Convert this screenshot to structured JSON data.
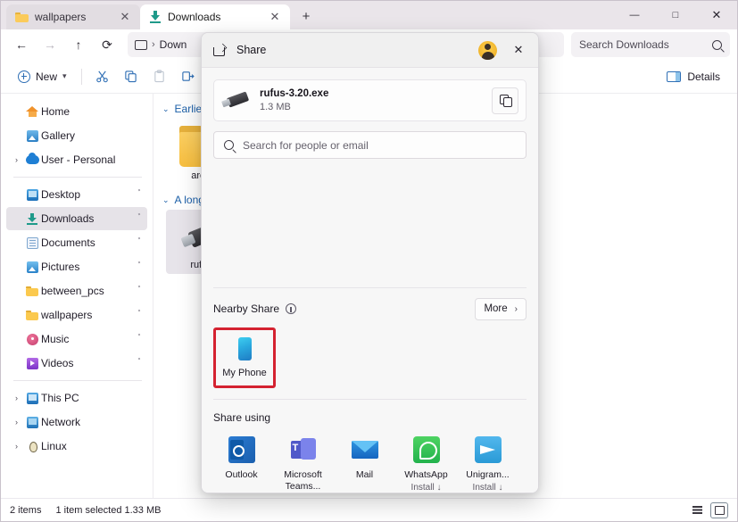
{
  "window": {
    "tabs": [
      {
        "label": "wallpapers",
        "icon": "folder-icon",
        "active": false
      },
      {
        "label": "Downloads",
        "icon": "download-icon",
        "active": true
      }
    ],
    "new_tab_glyph": "+",
    "controls": {
      "minimize": "—",
      "maximize": "□",
      "close": "✕"
    }
  },
  "nav": {
    "back": "←",
    "forward": "→",
    "up": "↑",
    "refresh": "⟳",
    "breadcrumb_sep": "›",
    "breadcrumb_text": "Down",
    "search_placeholder": "Search Downloads",
    "search_icon": "search-icon"
  },
  "toolbar": {
    "new_label": "New",
    "new_caret": "⌄",
    "cut_icon": "scissors-icon",
    "copy_icon": "copy-icon",
    "paste_icon": "paste-icon",
    "rename_icon": "rename-icon",
    "details_label": "Details"
  },
  "sidebar": {
    "items": [
      {
        "label": "Home",
        "icon": "home-icon",
        "chevron": "",
        "pin": false,
        "selected": false
      },
      {
        "label": "Gallery",
        "icon": "gallery-icon",
        "chevron": "",
        "pin": false,
        "selected": false
      },
      {
        "label": "User - Personal",
        "icon": "onedrive-icon",
        "chevron": "›",
        "pin": false,
        "selected": false
      },
      {
        "label": "Desktop",
        "icon": "desktop-icon",
        "chevron": "",
        "pin": true,
        "selected": false
      },
      {
        "label": "Downloads",
        "icon": "downloads-icon",
        "chevron": "",
        "pin": true,
        "selected": true
      },
      {
        "label": "Documents",
        "icon": "documents-icon",
        "chevron": "",
        "pin": true,
        "selected": false
      },
      {
        "label": "Pictures",
        "icon": "pictures-icon",
        "chevron": "",
        "pin": true,
        "selected": false
      },
      {
        "label": "between_pcs",
        "icon": "folder-icon",
        "chevron": "",
        "pin": true,
        "selected": false
      },
      {
        "label": "wallpapers",
        "icon": "folder-icon",
        "chevron": "",
        "pin": true,
        "selected": false
      },
      {
        "label": "Music",
        "icon": "music-icon",
        "chevron": "",
        "pin": true,
        "selected": false
      },
      {
        "label": "Videos",
        "icon": "videos-icon",
        "chevron": "",
        "pin": true,
        "selected": false
      },
      {
        "label": "This PC",
        "icon": "pc-icon",
        "chevron": "›",
        "pin": false,
        "selected": false
      },
      {
        "label": "Network",
        "icon": "network-icon",
        "chevron": "›",
        "pin": false,
        "selected": false
      },
      {
        "label": "Linux",
        "icon": "linux-icon",
        "chevron": "›",
        "pin": false,
        "selected": false
      }
    ],
    "pin_glyph": "ᐩ"
  },
  "content": {
    "groups": [
      {
        "header": "Earlier t",
        "chevron": "⌄",
        "item": {
          "label": "archiva",
          "type": "folder",
          "selected": false
        }
      },
      {
        "header": "A long t",
        "chevron": "⌄",
        "item": {
          "label": "rufus-3.",
          "type": "usb",
          "selected": true
        }
      }
    ]
  },
  "status": {
    "item_count": "2 items",
    "selection": "1 item selected  1.33 MB",
    "view_list_icon": "list-view-icon",
    "view_grid_icon": "large-icons-view-icon"
  },
  "share_dialog": {
    "title": "Share",
    "share_icon": "share-icon",
    "avatar": "account-avatar",
    "close_glyph": "✕",
    "file": {
      "name": "rufus-3.20.exe",
      "size": "1.3 MB",
      "thumbnail": "usb-drive-icon",
      "copy_icon": "copy-link-icon"
    },
    "people_search_placeholder": "Search for people or email",
    "nearby": {
      "title": "Nearby Share",
      "info_icon": "info-icon",
      "more_label": "More",
      "more_chevron": "›",
      "devices": [
        {
          "name": "My Phone",
          "icon": "phone-icon",
          "highlighted": true
        }
      ]
    },
    "share_using": {
      "title": "Share using",
      "apps": [
        {
          "name": "Outlook",
          "icon": "outlook-icon",
          "install": ""
        },
        {
          "name": "Microsoft Teams...",
          "icon": "teams-icon",
          "install": ""
        },
        {
          "name": "Mail",
          "icon": "mail-icon",
          "install": ""
        },
        {
          "name": "WhatsApp",
          "icon": "whatsapp-icon",
          "install": "Install ↓"
        },
        {
          "name": "Unigram...",
          "icon": "telegram-icon",
          "install": "Install ↓"
        }
      ]
    }
  },
  "colors": {
    "highlight_red": "#d42230",
    "accent_blue": "#2f6fb5",
    "titlebar_bg": "#eae5ea",
    "dialog_bg": "#f7f7f7"
  }
}
